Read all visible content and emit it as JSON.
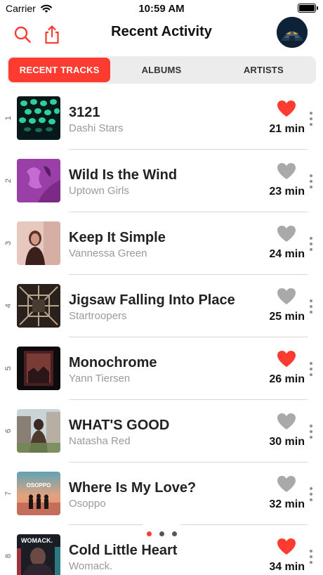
{
  "status": {
    "carrier": "Carrier",
    "time": "10:59 AM"
  },
  "nav": {
    "title": "Recent Activity",
    "icons": [
      "search-icon",
      "share-icon"
    ],
    "accent_color": "#fe3b30"
  },
  "tabs": [
    {
      "label": "RECENT TRACKS",
      "active": true
    },
    {
      "label": "ALBUMS",
      "active": false
    },
    {
      "label": "ARTISTS",
      "active": false
    }
  ],
  "tracks": [
    {
      "index": "1",
      "title": "3121",
      "artist": "Dashi Stars",
      "duration": "21 min",
      "liked": true
    },
    {
      "index": "2",
      "title": "Wild Is the Wind",
      "artist": "Uptown Girls",
      "duration": "23 min",
      "liked": false
    },
    {
      "index": "3",
      "title": "Keep It Simple",
      "artist": "Vannessa Green",
      "duration": "24 min",
      "liked": false
    },
    {
      "index": "4",
      "title": "Jigsaw Falling Into Place",
      "artist": "Startroopers",
      "duration": "25 min",
      "liked": false
    },
    {
      "index": "5",
      "title": "Monochrome",
      "artist": "Yann Tiersen",
      "duration": "26 min",
      "liked": true
    },
    {
      "index": "6",
      "title": "WHAT'S GOOD",
      "artist": "Natasha Red",
      "duration": "30 min",
      "liked": false
    },
    {
      "index": "7",
      "title": "Where Is My Love?",
      "artist": "Osoppo",
      "duration": "32 min",
      "liked": false
    },
    {
      "index": "8",
      "title": "Cold Little Heart",
      "artist": "Womack.",
      "duration": "34 min",
      "liked": true
    }
  ],
  "covers": [
    {
      "text": ""
    },
    {
      "text": ""
    },
    {
      "text": ""
    },
    {
      "text": ""
    },
    {
      "text": ""
    },
    {
      "text": ""
    },
    {
      "text": "OSOPPO"
    },
    {
      "text": "WOMACK."
    }
  ],
  "pager": {
    "pages": 3,
    "current": 1
  },
  "colors": {
    "liked": "#fe3b30",
    "unliked": "#a9a9a9"
  }
}
